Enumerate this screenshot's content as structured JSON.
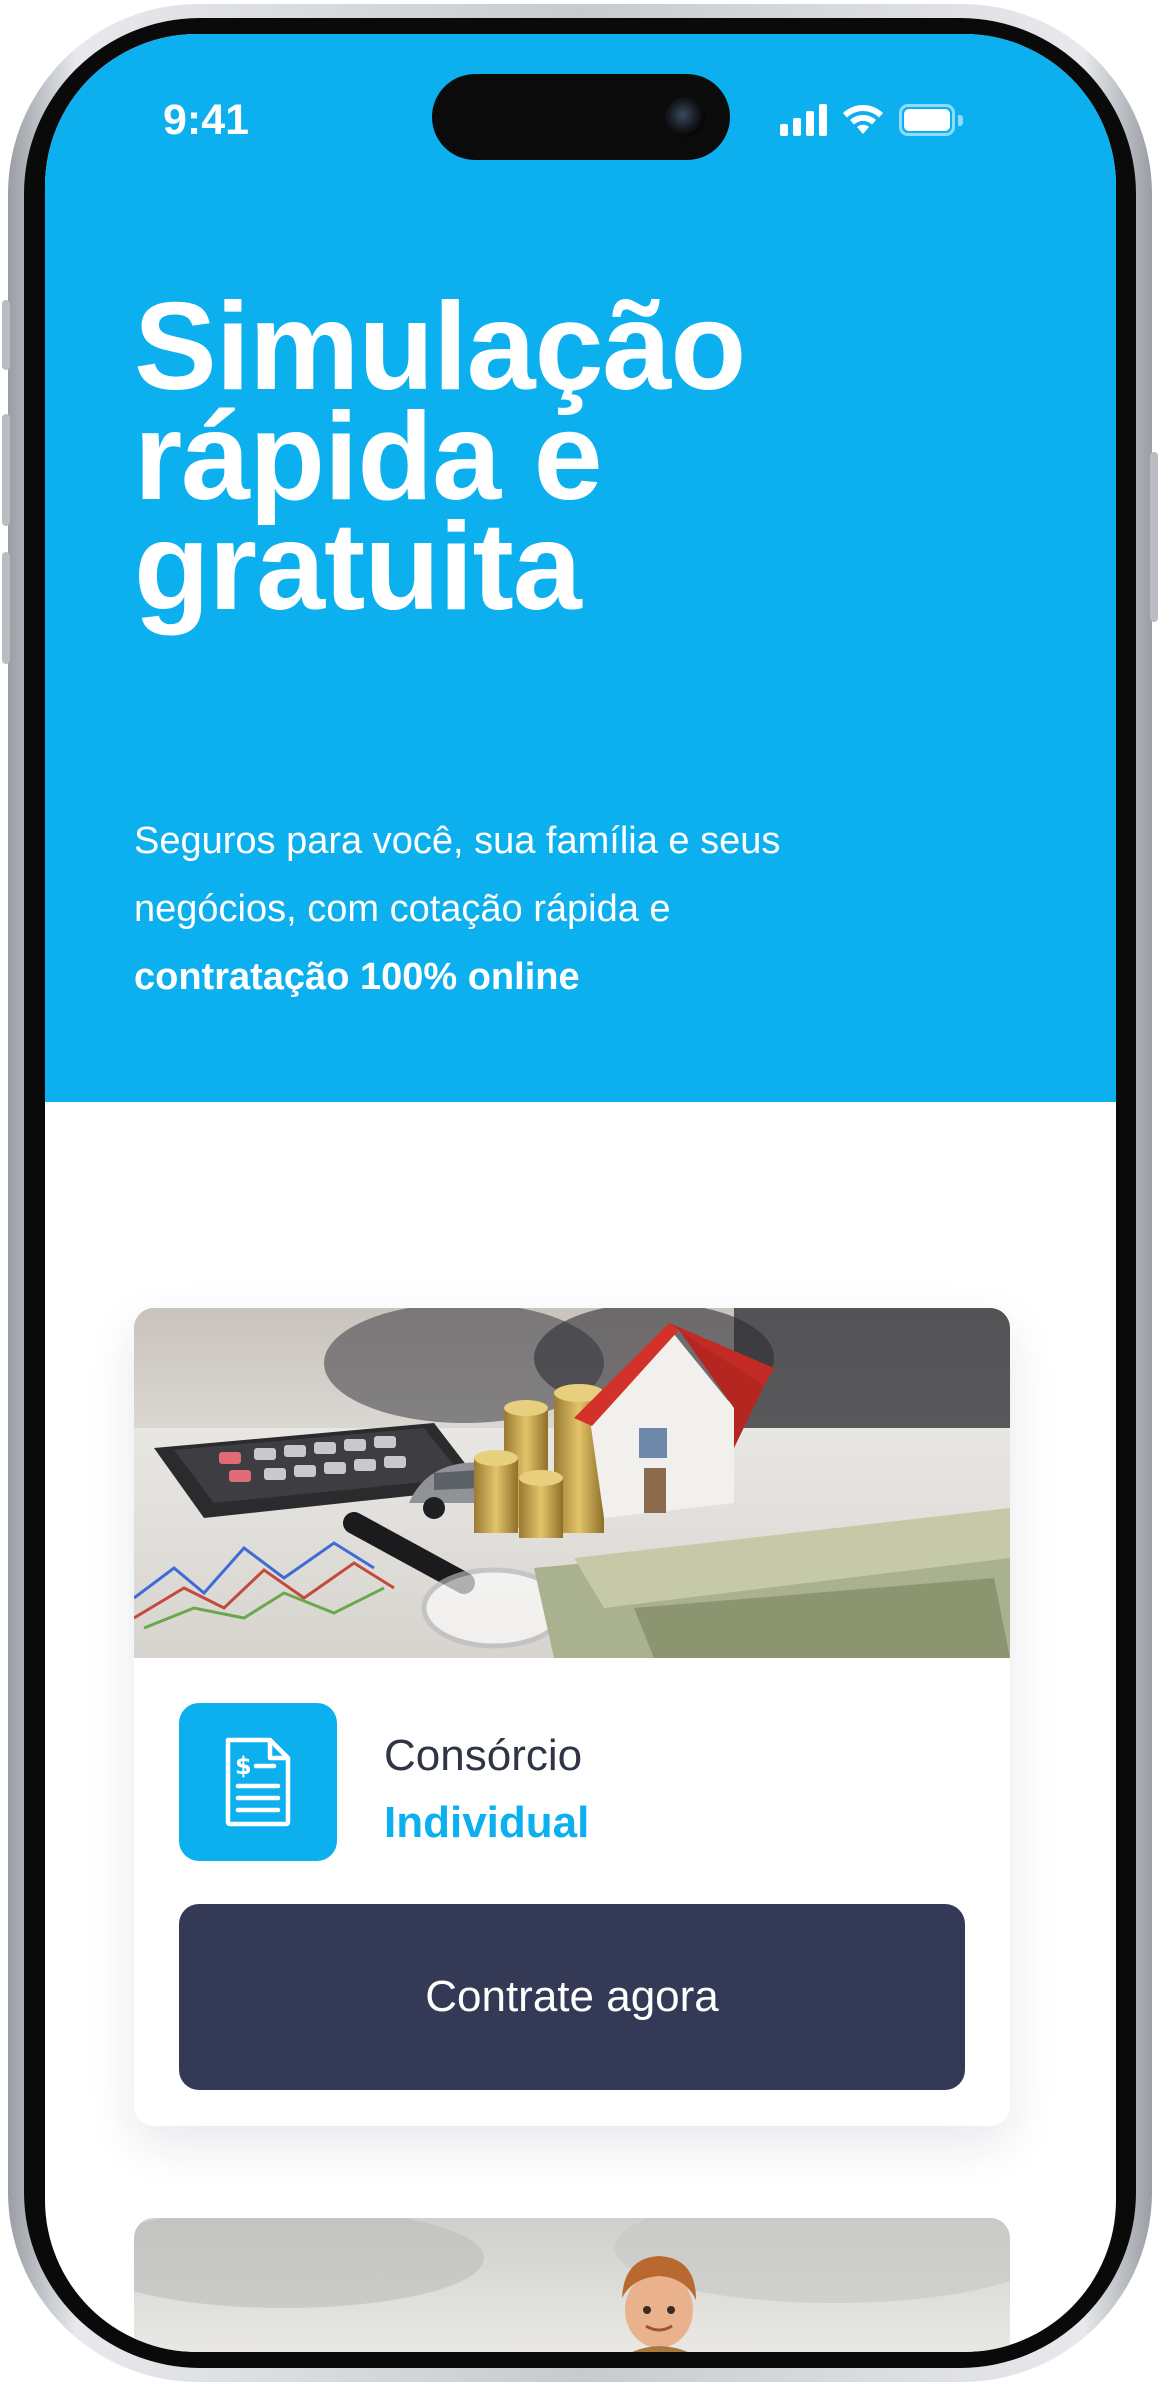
{
  "status_bar": {
    "time": "9:41",
    "icons": [
      "cellular-signal-icon",
      "wifi-icon",
      "battery-icon"
    ]
  },
  "hero": {
    "title_lines": [
      "Simulação",
      "rápida e",
      "gratuita"
    ],
    "subtitle_line1": "Seguros para você, sua família e seus",
    "subtitle_line2": "negócios, com cotação rápida e",
    "subtitle_bold": "contratação 100% online"
  },
  "cards": [
    {
      "image": "calculator-coins-car-house-photo",
      "icon": "document-dollar-icon",
      "label": "Consórcio",
      "sublabel": "Individual",
      "cta_label": "Contrate agora"
    },
    {
      "image": "child-sky-photo"
    }
  ],
  "colors": {
    "brand_blue": "#0db0ef",
    "button_navy": "#343a55",
    "label_text": "#2f3446"
  }
}
